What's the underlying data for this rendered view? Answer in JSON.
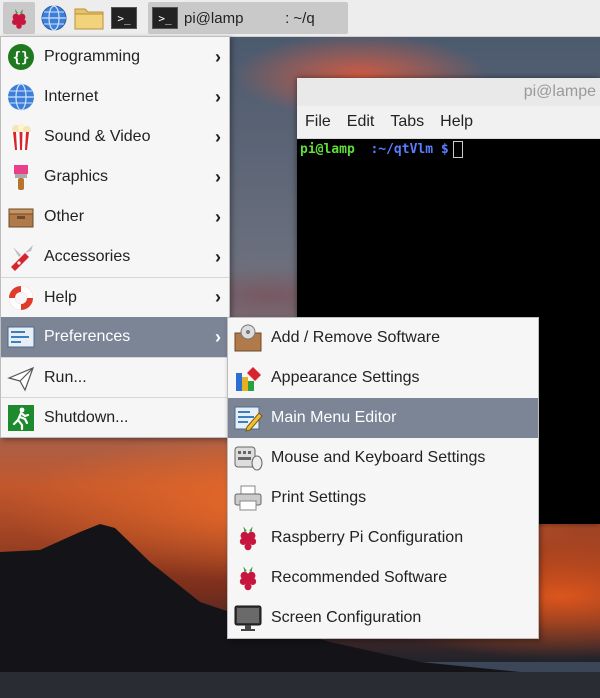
{
  "taskbar": {
    "task_label": "pi@lamp          : ~/q"
  },
  "terminal": {
    "title": "pi@lampe",
    "menus": [
      "File",
      "Edit",
      "Tabs",
      "Help"
    ],
    "prompt_user": "pi@lamp",
    "prompt_path": "  :~/qtVlm $"
  },
  "main_menu": {
    "items": [
      {
        "label": "Programming",
        "icon": "programming-icon",
        "has_submenu": true
      },
      {
        "label": "Internet",
        "icon": "globe-icon",
        "has_submenu": true
      },
      {
        "label": "Sound & Video",
        "icon": "popcorn-icon",
        "has_submenu": true
      },
      {
        "label": "Graphics",
        "icon": "paintbrush-icon",
        "has_submenu": true
      },
      {
        "label": "Other",
        "icon": "box-icon",
        "has_submenu": true
      },
      {
        "label": "Accessories",
        "icon": "pocketknife-icon",
        "has_submenu": true
      },
      {
        "label": "Help",
        "icon": "lifebuoy-icon",
        "has_submenu": true
      },
      {
        "label": "Preferences",
        "icon": "preferences-icon",
        "has_submenu": true
      },
      {
        "label": "Run...",
        "icon": "paper-plane-icon",
        "has_submenu": false
      },
      {
        "label": "Shutdown...",
        "icon": "exit-icon",
        "has_submenu": false
      }
    ],
    "arrow": "›"
  },
  "preferences_menu": {
    "items": [
      {
        "label": "Add / Remove Software",
        "icon": "package-icon"
      },
      {
        "label": "Appearance Settings",
        "icon": "appearance-icon"
      },
      {
        "label": "Main Menu Editor",
        "icon": "menu-editor-icon"
      },
      {
        "label": "Mouse and Keyboard Settings",
        "icon": "mouse-keyboard-icon"
      },
      {
        "label": "Print Settings",
        "icon": "printer-icon"
      },
      {
        "label": "Raspberry Pi Configuration",
        "icon": "raspberry-icon"
      },
      {
        "label": "Recommended Software",
        "icon": "raspberry-icon"
      },
      {
        "label": "Screen Configuration",
        "icon": "monitor-icon"
      }
    ]
  }
}
